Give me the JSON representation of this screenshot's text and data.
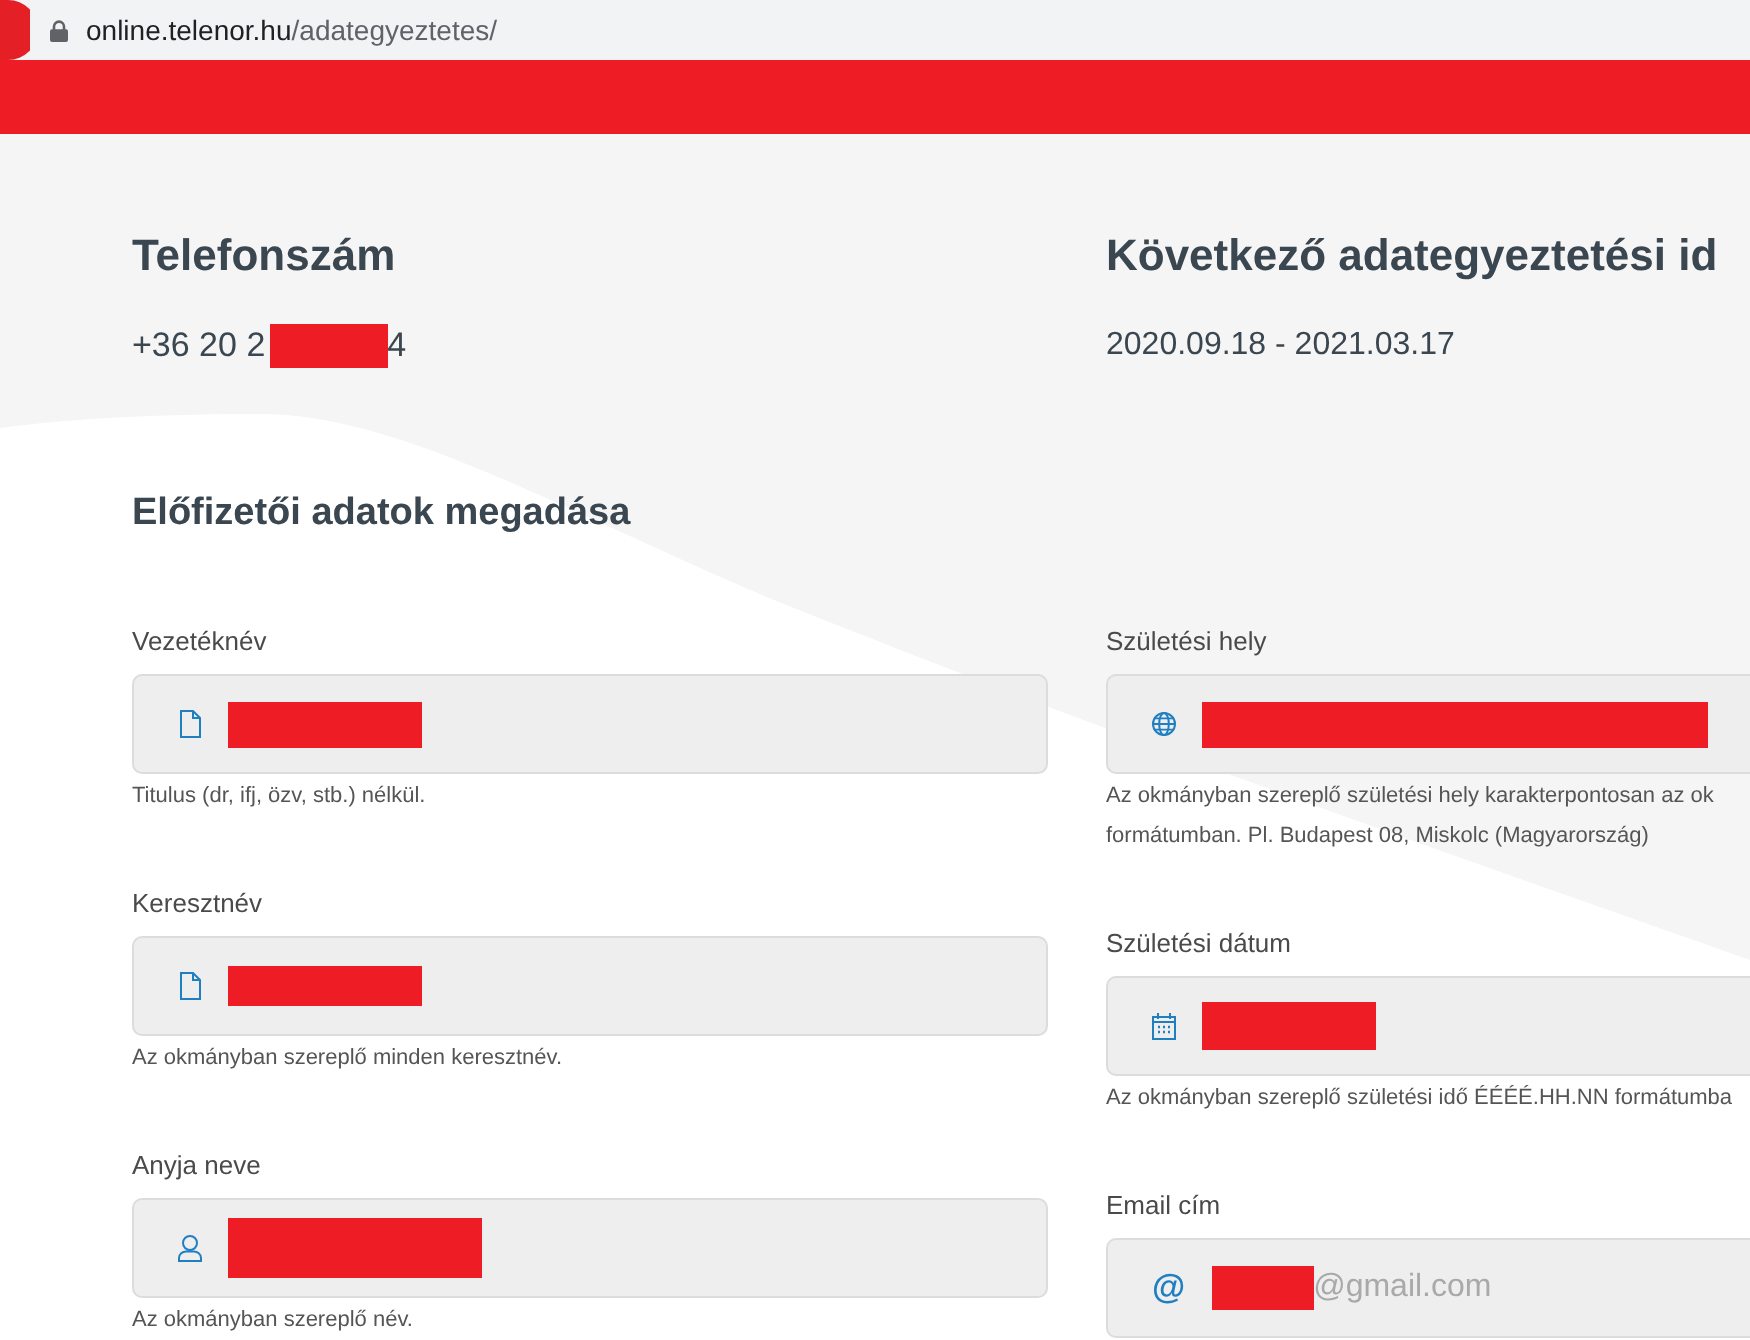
{
  "browser": {
    "url_host": "online.telenor.hu",
    "url_path": "/adategyeztetes/"
  },
  "summary": [
    {
      "title": "Telefonszám",
      "value": "+36 20 2",
      "redacted": true,
      "value_end": "4"
    },
    {
      "title": "Következő adategyeztetési id",
      "value": "2020.09.18 - 2021.03.17"
    }
  ],
  "section_title": "Előfizetői adatok megadása",
  "columns": [
    {
      "fields": [
        {
          "label": "Vezetéknév",
          "kind": "document",
          "redacted": true,
          "hint_lines": [
            "Titulus (dr, ifj, özv, stb.) nélkül."
          ]
        },
        {
          "label": "Keresztnév",
          "kind": "document",
          "redacted": true,
          "hint_lines": [
            "Az okmányban szereplő minden keresztnév."
          ]
        },
        {
          "label": "Anyja neve",
          "kind": "person",
          "redacted": true,
          "hint_lines": [
            "Az okmányban szereplő név."
          ]
        }
      ]
    },
    {
      "fields": [
        {
          "label": "Születési hely",
          "kind": "place",
          "redacted": true,
          "hint_lines": [
            "Az okmányban szereplő születési hely karakterpontosan az ok",
            "formátumban. Pl. Budapest 08, Miskolc (Magyarország)"
          ]
        },
        {
          "label": "Születési dátum",
          "kind": "date",
          "redacted": true,
          "hint_lines": [
            "Az okmányban szereplő születési idő ÉÉÉÉ.HH.NN formátumba"
          ]
        },
        {
          "label": "Email cím",
          "kind": "email",
          "icon_text": "@",
          "redacted": true,
          "value": "@gmail.com"
        }
      ]
    }
  ]
}
